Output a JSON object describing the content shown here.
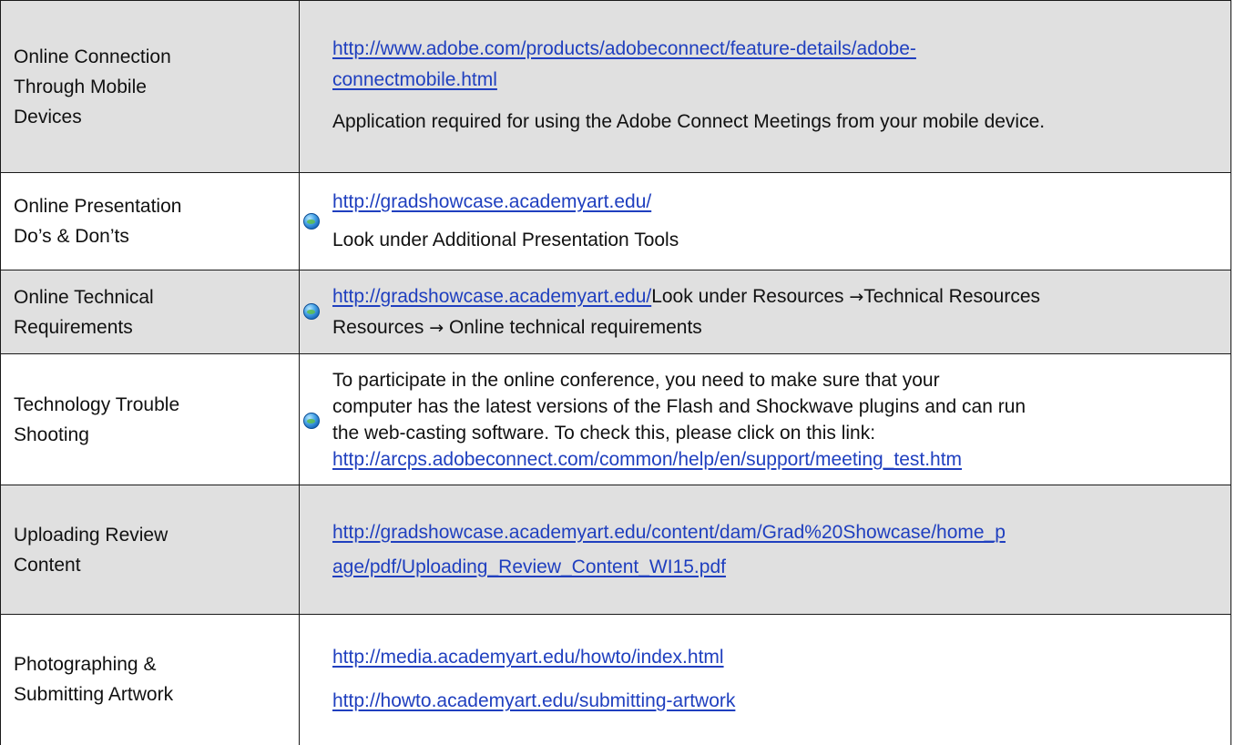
{
  "rows": [
    {
      "label": "Online Connection Through Mobile Devices",
      "link": "http://www.adobe.com/products/adobeconnect/feature-details/adobe-connectmobile.html",
      "link_line1": "http://www.adobe.com/products/adobeconnect/feature-details/adobe-",
      "link_line2": "connectmobile.html",
      "note": "Application required for using the Adobe Connect Meetings from your mobile device."
    },
    {
      "label": "Online Presentation Do’s & Don’ts",
      "link": "http://gradshowcase.academyart.edu/",
      "note": "Look under Additional Presentation Tools"
    },
    {
      "label": "Online Technical Requirements",
      "link": "http://gradshowcase.academyart.edu/",
      "note_part1": "Look under Resources ",
      "arrow": "→",
      "note_part2": "Technical Resources ",
      "note_part3": " Online technical requirements"
    },
    {
      "label": "Technology Trouble Shooting",
      "text_line1": "To participate in the online conference, you need to make sure that your",
      "text_line2": "computer has the latest versions of the Flash and Shockwave plugins and can run",
      "text_line3": "the web-casting software. To check this, please click on this link:",
      "link": "http://arcps.adobeconnect.com/common/help/en/support/meeting_test.htm"
    },
    {
      "label": "Uploading Review Content",
      "link": "http://gradshowcase.academyart.edu/content/dam/Grad%20Showcase/home_page/pdf/Uploading_Review_Content_WI15.pdf",
      "link_line1": "http://gradshowcase.academyart.edu/content/dam/Grad%20Showcase/home_p",
      "link_line2": "age/pdf/Uploading_Review_Content_WI15.pdf"
    },
    {
      "label": "Photographing & Submitting Artwork",
      "link1": "http://media.academyart.edu/howto/index.html",
      "link2": "http://howto.academyart.edu/submitting-artwork"
    }
  ],
  "icons": {
    "globe": "globe-icon"
  },
  "colors": {
    "link": "#1f3fbf",
    "row_shade": "#e0e0e0"
  }
}
